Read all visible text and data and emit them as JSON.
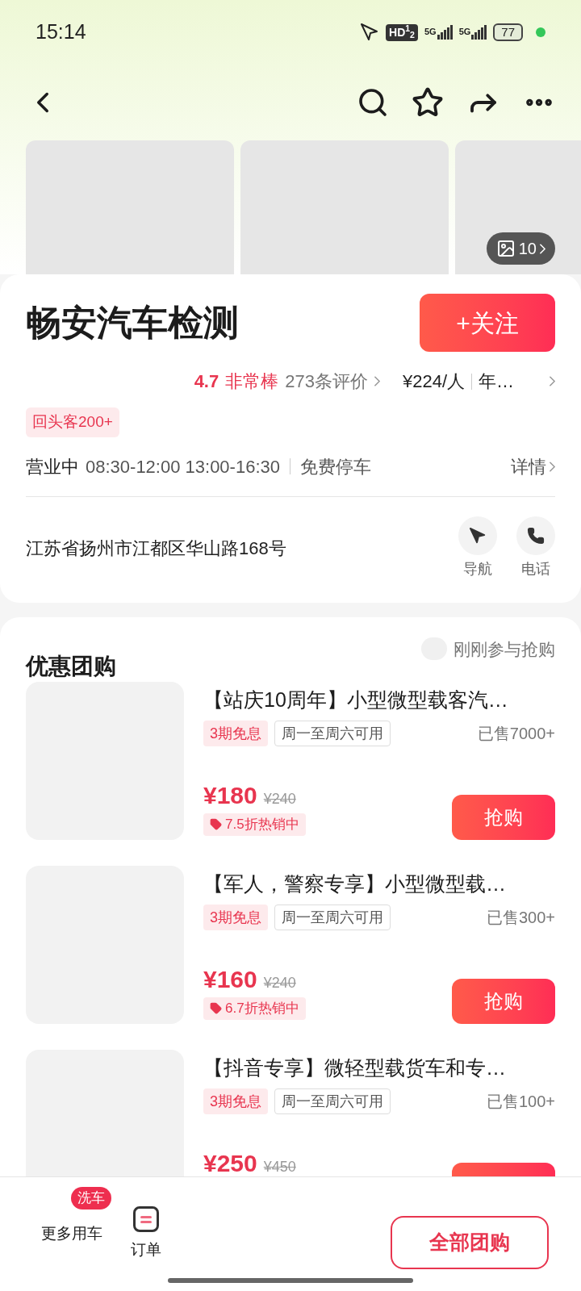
{
  "status_bar": {
    "time": "15:14",
    "hd": "HD$^{1}$$_{2}$",
    "networks": [
      "5G",
      "5G"
    ],
    "battery": "77"
  },
  "gallery": {
    "photo_count": "10"
  },
  "shop": {
    "name": "畅安汽车检测",
    "follow_button": "+关注",
    "score": "4.7",
    "score_label": "非常棒",
    "reviews": "273条评价",
    "price_per_person": "¥224/人",
    "extra": "年…",
    "tags": [
      "回头客200+"
    ],
    "status": "营业中",
    "hours": "08:30-12:00 13:00-16:30",
    "parking": "免费停车",
    "details_link": "详情",
    "address": "江苏省扬州市江都区华山路168号",
    "actions": [
      {
        "kind": "navigate",
        "label": "导航"
      },
      {
        "kind": "call",
        "label": "电话"
      }
    ]
  },
  "deals_section": {
    "title": "优惠团购",
    "ticker": "刚刚参与抢购",
    "deals": [
      {
        "title": "【站庆10周年】小型微型载客汽…",
        "tags": [
          {
            "kind": "promo",
            "text": "3期免息"
          },
          {
            "kind": "plain",
            "text": "周一至周六可用"
          }
        ],
        "sold": "已售7000+",
        "price": "¥180",
        "original_price": "¥240",
        "discount": "7.5折热销中",
        "button": "抢购"
      },
      {
        "title": "【军人，警察专享】小型微型载…",
        "tags": [
          {
            "kind": "promo",
            "text": "3期免息"
          },
          {
            "kind": "plain",
            "text": "周一至周六可用"
          }
        ],
        "sold": "已售300+",
        "price": "¥160",
        "original_price": "¥240",
        "discount": "6.7折热销中",
        "button": "抢购"
      },
      {
        "title": "【抖音专享】微轻型载货车和专…",
        "tags": [
          {
            "kind": "promo",
            "text": "3期免息"
          },
          {
            "kind": "plain",
            "text": "周一至周六可用"
          }
        ],
        "sold": "已售100+",
        "price": "¥250",
        "original_price": "¥450"
      }
    ]
  },
  "bottom_bar": {
    "items": [
      {
        "kind": "badge",
        "badge": "洗车",
        "label": "更多用车"
      },
      {
        "kind": "orders",
        "label": "订单"
      }
    ],
    "cta": "全部团购"
  }
}
